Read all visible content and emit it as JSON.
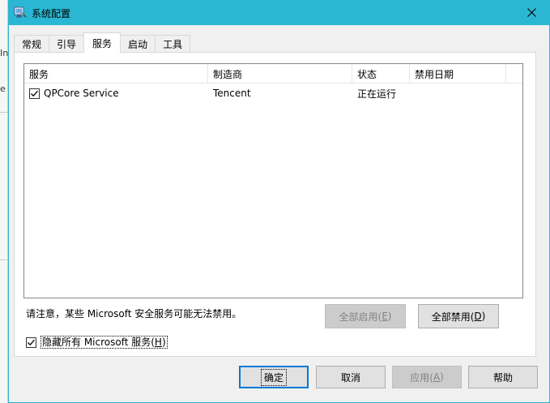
{
  "window": {
    "title": "系统配置",
    "close_glyph": "×"
  },
  "background": {
    "glyph_1": "In",
    "glyph_2": "e"
  },
  "tabs": [
    {
      "label": "常规",
      "active": false
    },
    {
      "label": "引导",
      "active": false
    },
    {
      "label": "服务",
      "active": true
    },
    {
      "label": "启动",
      "active": false
    },
    {
      "label": "工具",
      "active": false
    }
  ],
  "services": {
    "columns": [
      "服务",
      "制造商",
      "状态",
      "禁用日期"
    ],
    "rows": [
      {
        "checked": true,
        "service": "QPCore Service",
        "manufacturer": "Tencent",
        "status": "正在运行",
        "disabled_date": ""
      }
    ]
  },
  "notice": "请注意，某些 Microsoft 安全服务可能无法禁用。",
  "buttons": {
    "enable_all": {
      "text": "全部启用(",
      "mnemonic": "E",
      "suffix": ")",
      "enabled": false
    },
    "disable_all": {
      "text": "全部禁用(",
      "mnemonic": "D",
      "suffix": ")",
      "enabled": true
    },
    "ok": {
      "text": "确定",
      "enabled": true
    },
    "cancel": {
      "text": "取消",
      "enabled": true
    },
    "apply": {
      "text": "应用(",
      "mnemonic": "A",
      "suffix": ")",
      "enabled": false
    },
    "help": {
      "text": "帮助",
      "enabled": true
    }
  },
  "hide_microsoft": {
    "checked": true,
    "text": "隐藏所有 Microsoft 服务(",
    "mnemonic": "H",
    "suffix": ")"
  },
  "colors": {
    "titlebar": "#2ab7d3",
    "accent": "#0078d7"
  },
  "icons": {
    "title": "msconfig-icon",
    "close": "close-icon",
    "check": "checkmark-icon"
  }
}
